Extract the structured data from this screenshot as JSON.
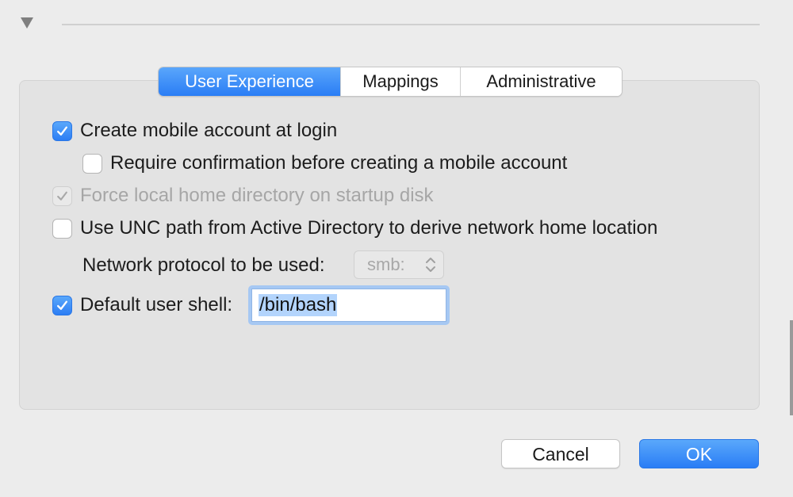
{
  "tabs": [
    {
      "label": "User Experience",
      "active": true
    },
    {
      "label": "Mappings",
      "active": false
    },
    {
      "label": "Administrative",
      "active": false
    }
  ],
  "options": {
    "create_mobile": {
      "label": "Create mobile account at login",
      "checked": true
    },
    "require_confirm": {
      "label": "Require confirmation before creating a mobile account",
      "checked": false
    },
    "force_local": {
      "label": "Force local home directory on startup disk",
      "checked": true,
      "disabled": true
    },
    "use_unc": {
      "label": "Use UNC path from Active Directory to derive network home location",
      "checked": false
    },
    "default_shell": {
      "label": "Default user shell:",
      "checked": true
    }
  },
  "network_protocol": {
    "label": "Network protocol to be used:",
    "value": "smb:"
  },
  "shell_value": "/bin/bash",
  "buttons": {
    "cancel": "Cancel",
    "ok": "OK"
  },
  "colors": {
    "accent": "#2a7df5",
    "panel": "#e3e3e3",
    "window": "#ececec"
  }
}
